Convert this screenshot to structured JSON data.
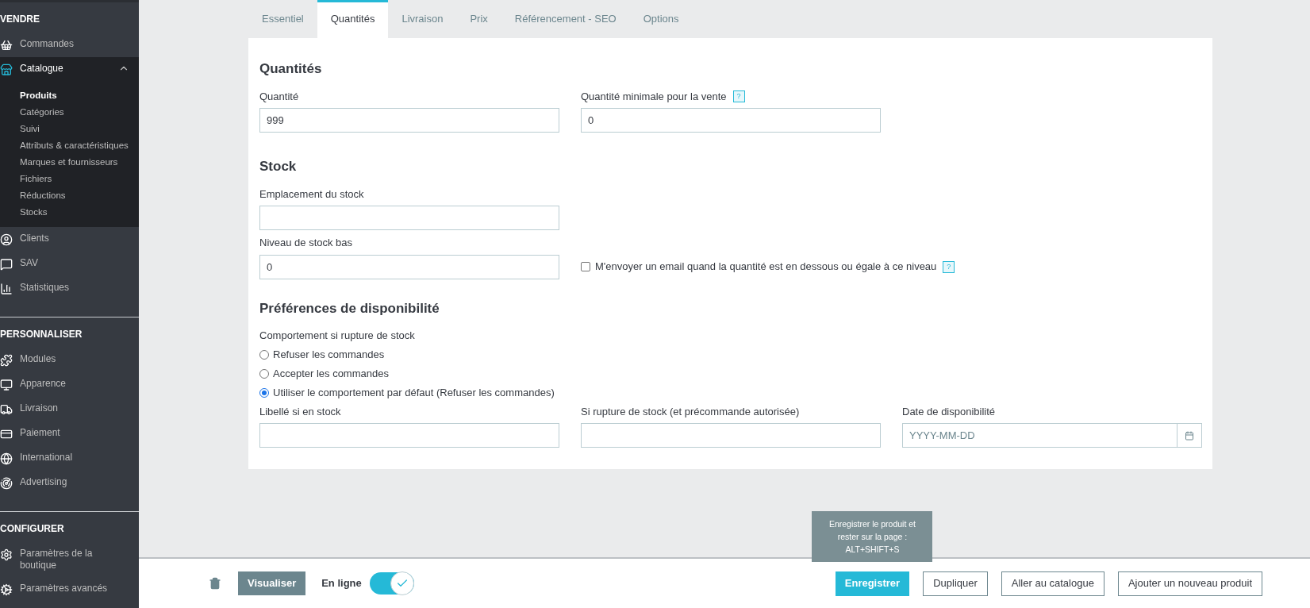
{
  "sidebar": {
    "sections": [
      {
        "title": "VENDRE",
        "items": [
          {
            "label": "Commandes",
            "selected": false
          },
          {
            "label": "Catalogue",
            "selected": true,
            "expanded": true,
            "children": [
              {
                "label": "Produits",
                "selected": true
              },
              {
                "label": "Catégories",
                "selected": false
              },
              {
                "label": "Suivi",
                "selected": false
              },
              {
                "label": "Attributs & caractéristiques",
                "selected": false
              },
              {
                "label": "Marques et fournisseurs",
                "selected": false
              },
              {
                "label": "Fichiers",
                "selected": false
              },
              {
                "label": "Réductions",
                "selected": false
              },
              {
                "label": "Stocks",
                "selected": false
              }
            ]
          },
          {
            "label": "Clients",
            "selected": false
          },
          {
            "label": "SAV",
            "selected": false
          },
          {
            "label": "Statistiques",
            "selected": false
          }
        ]
      },
      {
        "title": "PERSONNALISER",
        "items": [
          {
            "label": "Modules",
            "selected": false
          },
          {
            "label": "Apparence",
            "selected": false
          },
          {
            "label": "Livraison",
            "selected": false
          },
          {
            "label": "Paiement",
            "selected": false
          },
          {
            "label": "International",
            "selected": false
          },
          {
            "label": "Advertising",
            "selected": false
          }
        ]
      },
      {
        "title": "CONFIGURER",
        "items": [
          {
            "label": "Paramètres de la boutique",
            "selected": false
          },
          {
            "label": "Paramètres avancés",
            "selected": false
          }
        ]
      }
    ]
  },
  "tabs": [
    {
      "label": "Essentiel",
      "selected": false
    },
    {
      "label": "Quantités",
      "selected": true
    },
    {
      "label": "Livraison",
      "selected": false
    },
    {
      "label": "Prix",
      "selected": false
    },
    {
      "label": "Référencement - SEO",
      "selected": false
    },
    {
      "label": "Options",
      "selected": false
    }
  ],
  "quantities": {
    "title": "Quantités",
    "fields": [
      {
        "label": "Quantité",
        "value": "999"
      },
      {
        "label": "Quantité minimale pour la vente",
        "value": "0",
        "help": "?"
      }
    ]
  },
  "stock": {
    "title": "Stock",
    "location": {
      "label": "Emplacement du stock"
    },
    "low_stock": {
      "label": "Niveau de stock bas",
      "value": "0"
    },
    "email_alert": {
      "label": "M'envoyer un email quand la quantité est en dessous ou égale à ce niveau",
      "checked": false,
      "help": "?"
    }
  },
  "availability": {
    "title": "Préférences de disponibilité",
    "behavior_label": "Comportement si rupture de stock",
    "options": [
      {
        "label": "Refuser les commandes",
        "selected": false
      },
      {
        "label": "Accepter les commandes",
        "selected": false
      },
      {
        "label": "Utiliser le comportement par défaut (Refuser les commandes)",
        "selected": true
      }
    ],
    "fields": [
      {
        "kind": "text",
        "label": "Libellé si en stock"
      },
      {
        "kind": "text",
        "label": "Si rupture de stock (et précommande autorisée)"
      },
      {
        "kind": "date",
        "label": "Date de disponibilité",
        "placeholder": "YYYY-MM-DD"
      }
    ]
  },
  "footer": {
    "preview_button": "Visualiser",
    "online": {
      "label": "En ligne",
      "on": true
    },
    "tooltip": [
      "Enregistrer le produit et",
      "rester sur la page :",
      "ALT+SHIFT+S"
    ],
    "buttons": [
      {
        "label": "Enregistrer",
        "kind": "primary"
      },
      {
        "label": "Dupliquer",
        "kind": "outline"
      },
      {
        "label": "Aller au catalogue",
        "kind": "outline"
      },
      {
        "label": "Ajouter un nouveau produit",
        "kind": "outline"
      }
    ]
  }
}
